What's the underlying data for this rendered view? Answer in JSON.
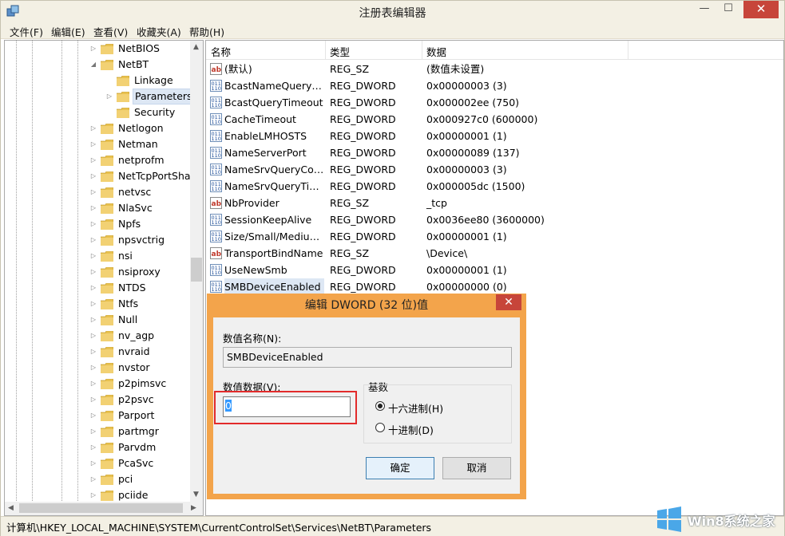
{
  "window": {
    "title": "注册表编辑器",
    "controls": {
      "minimize": "—",
      "maximize": "☐",
      "close": "✕"
    }
  },
  "menu": [
    "文件(F)",
    "编辑(E)",
    "查看(V)",
    "收藏夹(A)",
    "帮助(H)"
  ],
  "tree": {
    "nodes": [
      {
        "label": "NetBIOS",
        "level": 0,
        "arrow": "▷"
      },
      {
        "label": "NetBT",
        "level": 0,
        "arrow": "◢"
      },
      {
        "label": "Linkage",
        "level": 1,
        "arrow": ""
      },
      {
        "label": "Parameters",
        "level": 1,
        "arrow": "▷",
        "selected": true
      },
      {
        "label": "Security",
        "level": 1,
        "arrow": ""
      },
      {
        "label": "Netlogon",
        "level": 0,
        "arrow": "▷"
      },
      {
        "label": "Netman",
        "level": 0,
        "arrow": "▷"
      },
      {
        "label": "netprofm",
        "level": 0,
        "arrow": "▷"
      },
      {
        "label": "NetTcpPortSha",
        "level": 0,
        "arrow": "▷"
      },
      {
        "label": "netvsc",
        "level": 0,
        "arrow": "▷"
      },
      {
        "label": "NlaSvc",
        "level": 0,
        "arrow": "▷"
      },
      {
        "label": "Npfs",
        "level": 0,
        "arrow": "▷"
      },
      {
        "label": "npsvctrig",
        "level": 0,
        "arrow": "▷"
      },
      {
        "label": "nsi",
        "level": 0,
        "arrow": "▷"
      },
      {
        "label": "nsiproxy",
        "level": 0,
        "arrow": "▷"
      },
      {
        "label": "NTDS",
        "level": 0,
        "arrow": "▷"
      },
      {
        "label": "Ntfs",
        "level": 0,
        "arrow": "▷"
      },
      {
        "label": "Null",
        "level": 0,
        "arrow": "▷"
      },
      {
        "label": "nv_agp",
        "level": 0,
        "arrow": "▷"
      },
      {
        "label": "nvraid",
        "level": 0,
        "arrow": "▷"
      },
      {
        "label": "nvstor",
        "level": 0,
        "arrow": "▷"
      },
      {
        "label": "p2pimsvc",
        "level": 0,
        "arrow": "▷"
      },
      {
        "label": "p2psvc",
        "level": 0,
        "arrow": "▷"
      },
      {
        "label": "Parport",
        "level": 0,
        "arrow": "▷"
      },
      {
        "label": "partmgr",
        "level": 0,
        "arrow": "▷"
      },
      {
        "label": "Parvdm",
        "level": 0,
        "arrow": "▷"
      },
      {
        "label": "PcaSvc",
        "level": 0,
        "arrow": "▷"
      },
      {
        "label": "pci",
        "level": 0,
        "arrow": "▷"
      },
      {
        "label": "pciide",
        "level": 0,
        "arrow": "▷"
      }
    ]
  },
  "list": {
    "columns": [
      "名称",
      "类型",
      "数据"
    ],
    "rows": [
      {
        "icon": "string-value-icon",
        "name": "(默认)",
        "type": "REG_SZ",
        "data": "(数值未设置)"
      },
      {
        "icon": "binary-value-icon",
        "name": "BcastNameQueryC...",
        "type": "REG_DWORD",
        "data": "0x00000003 (3)"
      },
      {
        "icon": "binary-value-icon",
        "name": "BcastQueryTimeout",
        "type": "REG_DWORD",
        "data": "0x000002ee (750)"
      },
      {
        "icon": "binary-value-icon",
        "name": "CacheTimeout",
        "type": "REG_DWORD",
        "data": "0x000927c0 (600000)"
      },
      {
        "icon": "binary-value-icon",
        "name": "EnableLMHOSTS",
        "type": "REG_DWORD",
        "data": "0x00000001 (1)"
      },
      {
        "icon": "binary-value-icon",
        "name": "NameServerPort",
        "type": "REG_DWORD",
        "data": "0x00000089 (137)"
      },
      {
        "icon": "binary-value-icon",
        "name": "NameSrvQueryCount",
        "type": "REG_DWORD",
        "data": "0x00000003 (3)"
      },
      {
        "icon": "binary-value-icon",
        "name": "NameSrvQueryTim...",
        "type": "REG_DWORD",
        "data": "0x000005dc (1500)"
      },
      {
        "icon": "string-value-icon",
        "name": "NbProvider",
        "type": "REG_SZ",
        "data": "_tcp"
      },
      {
        "icon": "binary-value-icon",
        "name": "SessionKeepAlive",
        "type": "REG_DWORD",
        "data": "0x0036ee80 (3600000)"
      },
      {
        "icon": "binary-value-icon",
        "name": "Size/Small/Medium...",
        "type": "REG_DWORD",
        "data": "0x00000001 (1)"
      },
      {
        "icon": "string-value-icon",
        "name": "TransportBindName",
        "type": "REG_SZ",
        "data": "\\Device\\"
      },
      {
        "icon": "binary-value-icon",
        "name": "UseNewSmb",
        "type": "REG_DWORD",
        "data": "0x00000001 (1)"
      },
      {
        "icon": "binary-value-icon",
        "name": "SMBDeviceEnabled",
        "type": "REG_DWORD",
        "data": "0x00000000 (0)",
        "selected": true
      }
    ]
  },
  "dialog": {
    "title": "编辑 DWORD (32 位)值",
    "close": "✕",
    "name_label": "数值名称(N):",
    "name_value": "SMBDeviceEnabled",
    "data_label": "数值数据(V):",
    "data_value": "0",
    "base_label": "基数",
    "radio_hex": "十六进制(H)",
    "radio_dec": "十进制(D)",
    "base_selected": "hex",
    "ok": "确定",
    "cancel": "取消"
  },
  "status": {
    "path": "计算机\\HKEY_LOCAL_MACHINE\\SYSTEM\\CurrentControlSet\\Services\\NetBT\\Parameters"
  },
  "watermark": {
    "text": "Win8系统之家"
  },
  "colors": {
    "folder": "#e8c14f",
    "accent": "#3399ff",
    "close": "#c7453a",
    "dialog_frame": "#f3a44b",
    "highlight": "#e22b2b"
  }
}
